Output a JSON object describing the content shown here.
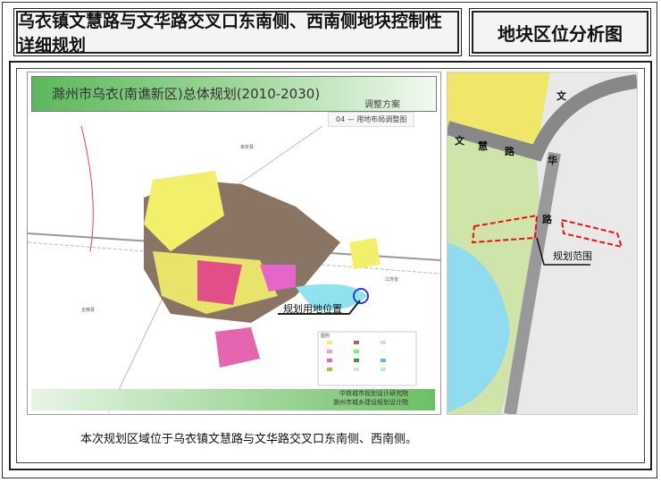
{
  "header": {
    "title": "乌衣镇文慧路与文华路交叉口东南侧、西南侧地块控制性详细规划",
    "section": "地块区位分析图"
  },
  "map": {
    "title": "滁州市乌衣(南谯新区)总体规划(2010-2030)",
    "subtitle": "调整方案",
    "sheet": "04 — 用地布局调整图",
    "site_label": "规划用地位置",
    "place_labels": [
      "来安县",
      "全椒县",
      "江苏省"
    ],
    "legend_title": "图例",
    "credits": [
      "中铁城市规划设计研究院",
      "滁州市城乡建设规划设计院"
    ]
  },
  "detail": {
    "road_labels": [
      "文",
      "文",
      "慧",
      "路",
      "华",
      "路"
    ],
    "scope_label": "规划范围"
  },
  "caption": "本次规划区域位于乌衣镇文慧路与文华路交叉口东南侧、西南侧。"
}
